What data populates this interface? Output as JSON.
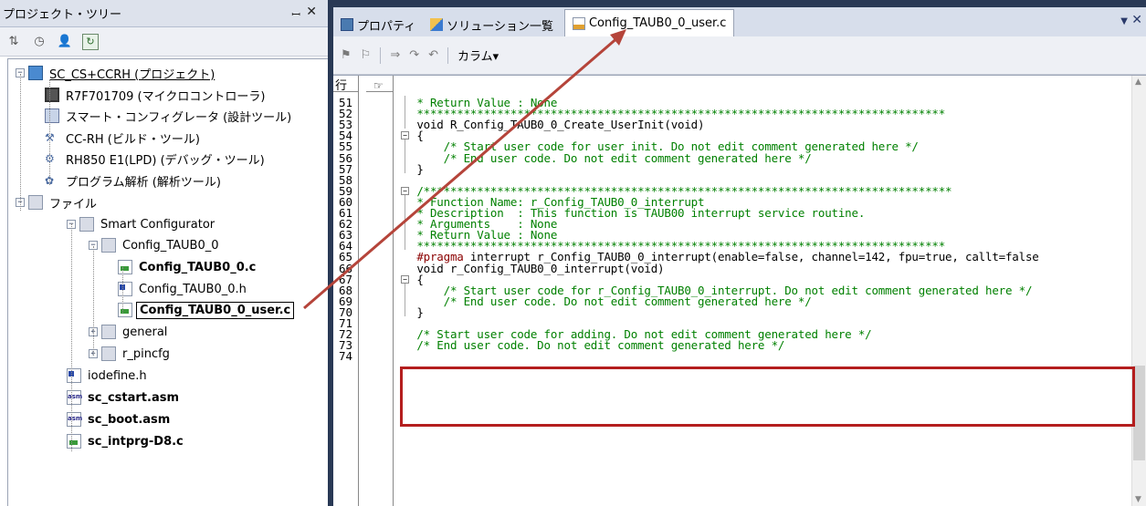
{
  "left_pane": {
    "title": "プロジェクト・ツリー",
    "pin": "ꟷ",
    "close": "✕",
    "toolbar": [
      "sort-icon",
      "clock-icon",
      "person-icon",
      "refresh-icon"
    ],
    "tree": [
      {
        "label": "SC_CS+CCRH (プロジェクト)",
        "icon": "project-icon"
      },
      {
        "label": "R7F701709 (マイクロコントローラ)",
        "icon": "chip-icon"
      },
      {
        "label": "スマート・コンフィグレータ (設計ツール)",
        "icon": "config-icon"
      },
      {
        "label": "CC-RH (ビルド・ツール)",
        "icon": "build-tool-icon"
      },
      {
        "label": "RH850 E1(LPD) (デバッグ・ツール)",
        "icon": "debug-tool-icon"
      },
      {
        "label": "プログラム解析 (解析ツール)",
        "icon": "analysis-icon"
      },
      {
        "label": "ファイル",
        "icon": "folder-icon"
      },
      {
        "label": "Smart Configurator",
        "icon": "folder-icon"
      },
      {
        "label": "Config_TAUB0_0",
        "icon": "folder-icon"
      },
      {
        "label": "Config_TAUB0_0.c",
        "icon": "c-file-icon"
      },
      {
        "label": "Config_TAUB0_0.h",
        "icon": "h-file-icon"
      },
      {
        "label": "Config_TAUB0_0_user.c",
        "icon": "c-file-icon"
      },
      {
        "label": "general",
        "icon": "folder-icon"
      },
      {
        "label": "r_pincfg",
        "icon": "folder-icon"
      },
      {
        "label": "iodefine.h",
        "icon": "h-file-icon"
      },
      {
        "label": "sc_cstart.asm",
        "icon": "asm-file-icon"
      },
      {
        "label": "sc_boot.asm",
        "icon": "asm-file-icon"
      },
      {
        "label": "sc_intprg-D8.c",
        "icon": "c-file-icon"
      }
    ]
  },
  "tabs": [
    {
      "label": "プロパティ",
      "icon": "property-icon"
    },
    {
      "label": "ソリューション一覧",
      "icon": "solution-icon"
    },
    {
      "label": "Config_TAUB0_0_user.c",
      "icon": "c-file-icon",
      "active": true
    }
  ],
  "editor_toolbar": {
    "column_label": "カラム"
  },
  "gutter_header": "行",
  "lines": [
    {
      "no": "51",
      "parts": [
        [
          "c-cm",
          " * Return Value : None"
        ]
      ]
    },
    {
      "no": "52",
      "parts": [
        [
          "c-cm",
          " *******************************************************************************"
        ]
      ]
    },
    {
      "no": "53",
      "parts": [
        [
          "c-tx",
          " void R_Config_TAUB0_0_Create_UserInit(void)"
        ]
      ]
    },
    {
      "no": "54",
      "parts": [
        [
          "c-tx",
          " {"
        ]
      ]
    },
    {
      "no": "55",
      "parts": [
        [
          "c-cm",
          "     /* Start user code for user init. Do not edit comment generated here */"
        ]
      ]
    },
    {
      "no": "56",
      "parts": [
        [
          "c-cm",
          "     /* End user code. Do not edit comment generated here */"
        ]
      ]
    },
    {
      "no": "57",
      "parts": [
        [
          "c-tx",
          " }"
        ]
      ]
    },
    {
      "no": "58",
      "parts": [
        [
          "c-tx",
          ""
        ]
      ]
    },
    {
      "no": "59",
      "parts": [
        [
          "c-cm",
          " /*******************************************************************************"
        ]
      ]
    },
    {
      "no": "60",
      "parts": [
        [
          "c-cm",
          " * Function Name: r_Config_TAUB0_0_interrupt"
        ]
      ]
    },
    {
      "no": "61",
      "parts": [
        [
          "c-cm",
          " * Description  : This function is TAUB00 interrupt service routine."
        ]
      ]
    },
    {
      "no": "62",
      "parts": [
        [
          "c-cm",
          " * Arguments    : None"
        ]
      ]
    },
    {
      "no": "63",
      "parts": [
        [
          "c-cm",
          " * Return Value : None"
        ]
      ]
    },
    {
      "no": "64",
      "parts": [
        [
          "c-cm",
          " *******************************************************************************"
        ]
      ]
    },
    {
      "no": "65",
      "parts": [
        [
          "c-pp",
          " #pragma"
        ],
        [
          "c-tx",
          " interrupt r_Config_TAUB0_0_interrupt(enable=false, channel=142, fpu=true, callt=false"
        ]
      ]
    },
    {
      "no": "66",
      "parts": [
        [
          "c-tx",
          " void r_Config_TAUB0_0_interrupt(void)"
        ]
      ]
    },
    {
      "no": "67",
      "parts": [
        [
          "c-tx",
          " {"
        ]
      ]
    },
    {
      "no": "68",
      "parts": [
        [
          "c-cm",
          "     /* Start user code for r_Config_TAUB0_0_interrupt. Do not edit comment generated here */"
        ]
      ]
    },
    {
      "no": "69",
      "parts": [
        [
          "c-cm",
          "     /* End user code. Do not edit comment generated here */"
        ]
      ]
    },
    {
      "no": "70",
      "parts": [
        [
          "c-tx",
          " }"
        ]
      ]
    },
    {
      "no": "71",
      "parts": [
        [
          "c-tx",
          ""
        ]
      ]
    },
    {
      "no": "72",
      "parts": [
        [
          "c-cm",
          " /* Start user code for adding. Do not edit comment generated here */"
        ]
      ]
    },
    {
      "no": "73",
      "parts": [
        [
          "c-cm",
          " /* End user code. Do not edit comment generated here */"
        ]
      ]
    },
    {
      "no": "74",
      "parts": [
        [
          "c-tx",
          ""
        ]
      ]
    }
  ],
  "colors": {
    "highlight": "#b41e1e",
    "arrow": "#b5443a",
    "comment": "#008000",
    "pragma": "#8b0000"
  }
}
